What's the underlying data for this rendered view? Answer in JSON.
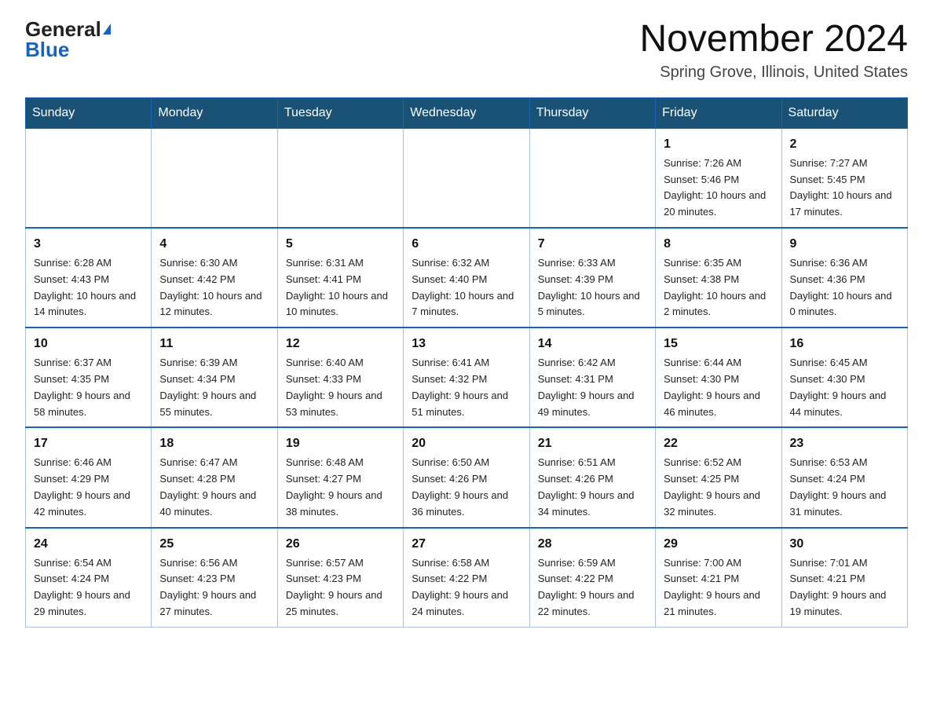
{
  "logo": {
    "general": "General",
    "blue": "Blue"
  },
  "title": "November 2024",
  "location": "Spring Grove, Illinois, United States",
  "days_of_week": [
    "Sunday",
    "Monday",
    "Tuesday",
    "Wednesday",
    "Thursday",
    "Friday",
    "Saturday"
  ],
  "weeks": [
    [
      {
        "num": "",
        "sunrise": "",
        "sunset": "",
        "daylight": ""
      },
      {
        "num": "",
        "sunrise": "",
        "sunset": "",
        "daylight": ""
      },
      {
        "num": "",
        "sunrise": "",
        "sunset": "",
        "daylight": ""
      },
      {
        "num": "",
        "sunrise": "",
        "sunset": "",
        "daylight": ""
      },
      {
        "num": "",
        "sunrise": "",
        "sunset": "",
        "daylight": ""
      },
      {
        "num": "1",
        "sunrise": "Sunrise: 7:26 AM",
        "sunset": "Sunset: 5:46 PM",
        "daylight": "Daylight: 10 hours and 20 minutes."
      },
      {
        "num": "2",
        "sunrise": "Sunrise: 7:27 AM",
        "sunset": "Sunset: 5:45 PM",
        "daylight": "Daylight: 10 hours and 17 minutes."
      }
    ],
    [
      {
        "num": "3",
        "sunrise": "Sunrise: 6:28 AM",
        "sunset": "Sunset: 4:43 PM",
        "daylight": "Daylight: 10 hours and 14 minutes."
      },
      {
        "num": "4",
        "sunrise": "Sunrise: 6:30 AM",
        "sunset": "Sunset: 4:42 PM",
        "daylight": "Daylight: 10 hours and 12 minutes."
      },
      {
        "num": "5",
        "sunrise": "Sunrise: 6:31 AM",
        "sunset": "Sunset: 4:41 PM",
        "daylight": "Daylight: 10 hours and 10 minutes."
      },
      {
        "num": "6",
        "sunrise": "Sunrise: 6:32 AM",
        "sunset": "Sunset: 4:40 PM",
        "daylight": "Daylight: 10 hours and 7 minutes."
      },
      {
        "num": "7",
        "sunrise": "Sunrise: 6:33 AM",
        "sunset": "Sunset: 4:39 PM",
        "daylight": "Daylight: 10 hours and 5 minutes."
      },
      {
        "num": "8",
        "sunrise": "Sunrise: 6:35 AM",
        "sunset": "Sunset: 4:38 PM",
        "daylight": "Daylight: 10 hours and 2 minutes."
      },
      {
        "num": "9",
        "sunrise": "Sunrise: 6:36 AM",
        "sunset": "Sunset: 4:36 PM",
        "daylight": "Daylight: 10 hours and 0 minutes."
      }
    ],
    [
      {
        "num": "10",
        "sunrise": "Sunrise: 6:37 AM",
        "sunset": "Sunset: 4:35 PM",
        "daylight": "Daylight: 9 hours and 58 minutes."
      },
      {
        "num": "11",
        "sunrise": "Sunrise: 6:39 AM",
        "sunset": "Sunset: 4:34 PM",
        "daylight": "Daylight: 9 hours and 55 minutes."
      },
      {
        "num": "12",
        "sunrise": "Sunrise: 6:40 AM",
        "sunset": "Sunset: 4:33 PM",
        "daylight": "Daylight: 9 hours and 53 minutes."
      },
      {
        "num": "13",
        "sunrise": "Sunrise: 6:41 AM",
        "sunset": "Sunset: 4:32 PM",
        "daylight": "Daylight: 9 hours and 51 minutes."
      },
      {
        "num": "14",
        "sunrise": "Sunrise: 6:42 AM",
        "sunset": "Sunset: 4:31 PM",
        "daylight": "Daylight: 9 hours and 49 minutes."
      },
      {
        "num": "15",
        "sunrise": "Sunrise: 6:44 AM",
        "sunset": "Sunset: 4:30 PM",
        "daylight": "Daylight: 9 hours and 46 minutes."
      },
      {
        "num": "16",
        "sunrise": "Sunrise: 6:45 AM",
        "sunset": "Sunset: 4:30 PM",
        "daylight": "Daylight: 9 hours and 44 minutes."
      }
    ],
    [
      {
        "num": "17",
        "sunrise": "Sunrise: 6:46 AM",
        "sunset": "Sunset: 4:29 PM",
        "daylight": "Daylight: 9 hours and 42 minutes."
      },
      {
        "num": "18",
        "sunrise": "Sunrise: 6:47 AM",
        "sunset": "Sunset: 4:28 PM",
        "daylight": "Daylight: 9 hours and 40 minutes."
      },
      {
        "num": "19",
        "sunrise": "Sunrise: 6:48 AM",
        "sunset": "Sunset: 4:27 PM",
        "daylight": "Daylight: 9 hours and 38 minutes."
      },
      {
        "num": "20",
        "sunrise": "Sunrise: 6:50 AM",
        "sunset": "Sunset: 4:26 PM",
        "daylight": "Daylight: 9 hours and 36 minutes."
      },
      {
        "num": "21",
        "sunrise": "Sunrise: 6:51 AM",
        "sunset": "Sunset: 4:26 PM",
        "daylight": "Daylight: 9 hours and 34 minutes."
      },
      {
        "num": "22",
        "sunrise": "Sunrise: 6:52 AM",
        "sunset": "Sunset: 4:25 PM",
        "daylight": "Daylight: 9 hours and 32 minutes."
      },
      {
        "num": "23",
        "sunrise": "Sunrise: 6:53 AM",
        "sunset": "Sunset: 4:24 PM",
        "daylight": "Daylight: 9 hours and 31 minutes."
      }
    ],
    [
      {
        "num": "24",
        "sunrise": "Sunrise: 6:54 AM",
        "sunset": "Sunset: 4:24 PM",
        "daylight": "Daylight: 9 hours and 29 minutes."
      },
      {
        "num": "25",
        "sunrise": "Sunrise: 6:56 AM",
        "sunset": "Sunset: 4:23 PM",
        "daylight": "Daylight: 9 hours and 27 minutes."
      },
      {
        "num": "26",
        "sunrise": "Sunrise: 6:57 AM",
        "sunset": "Sunset: 4:23 PM",
        "daylight": "Daylight: 9 hours and 25 minutes."
      },
      {
        "num": "27",
        "sunrise": "Sunrise: 6:58 AM",
        "sunset": "Sunset: 4:22 PM",
        "daylight": "Daylight: 9 hours and 24 minutes."
      },
      {
        "num": "28",
        "sunrise": "Sunrise: 6:59 AM",
        "sunset": "Sunset: 4:22 PM",
        "daylight": "Daylight: 9 hours and 22 minutes."
      },
      {
        "num": "29",
        "sunrise": "Sunrise: 7:00 AM",
        "sunset": "Sunset: 4:21 PM",
        "daylight": "Daylight: 9 hours and 21 minutes."
      },
      {
        "num": "30",
        "sunrise": "Sunrise: 7:01 AM",
        "sunset": "Sunset: 4:21 PM",
        "daylight": "Daylight: 9 hours and 19 minutes."
      }
    ]
  ]
}
